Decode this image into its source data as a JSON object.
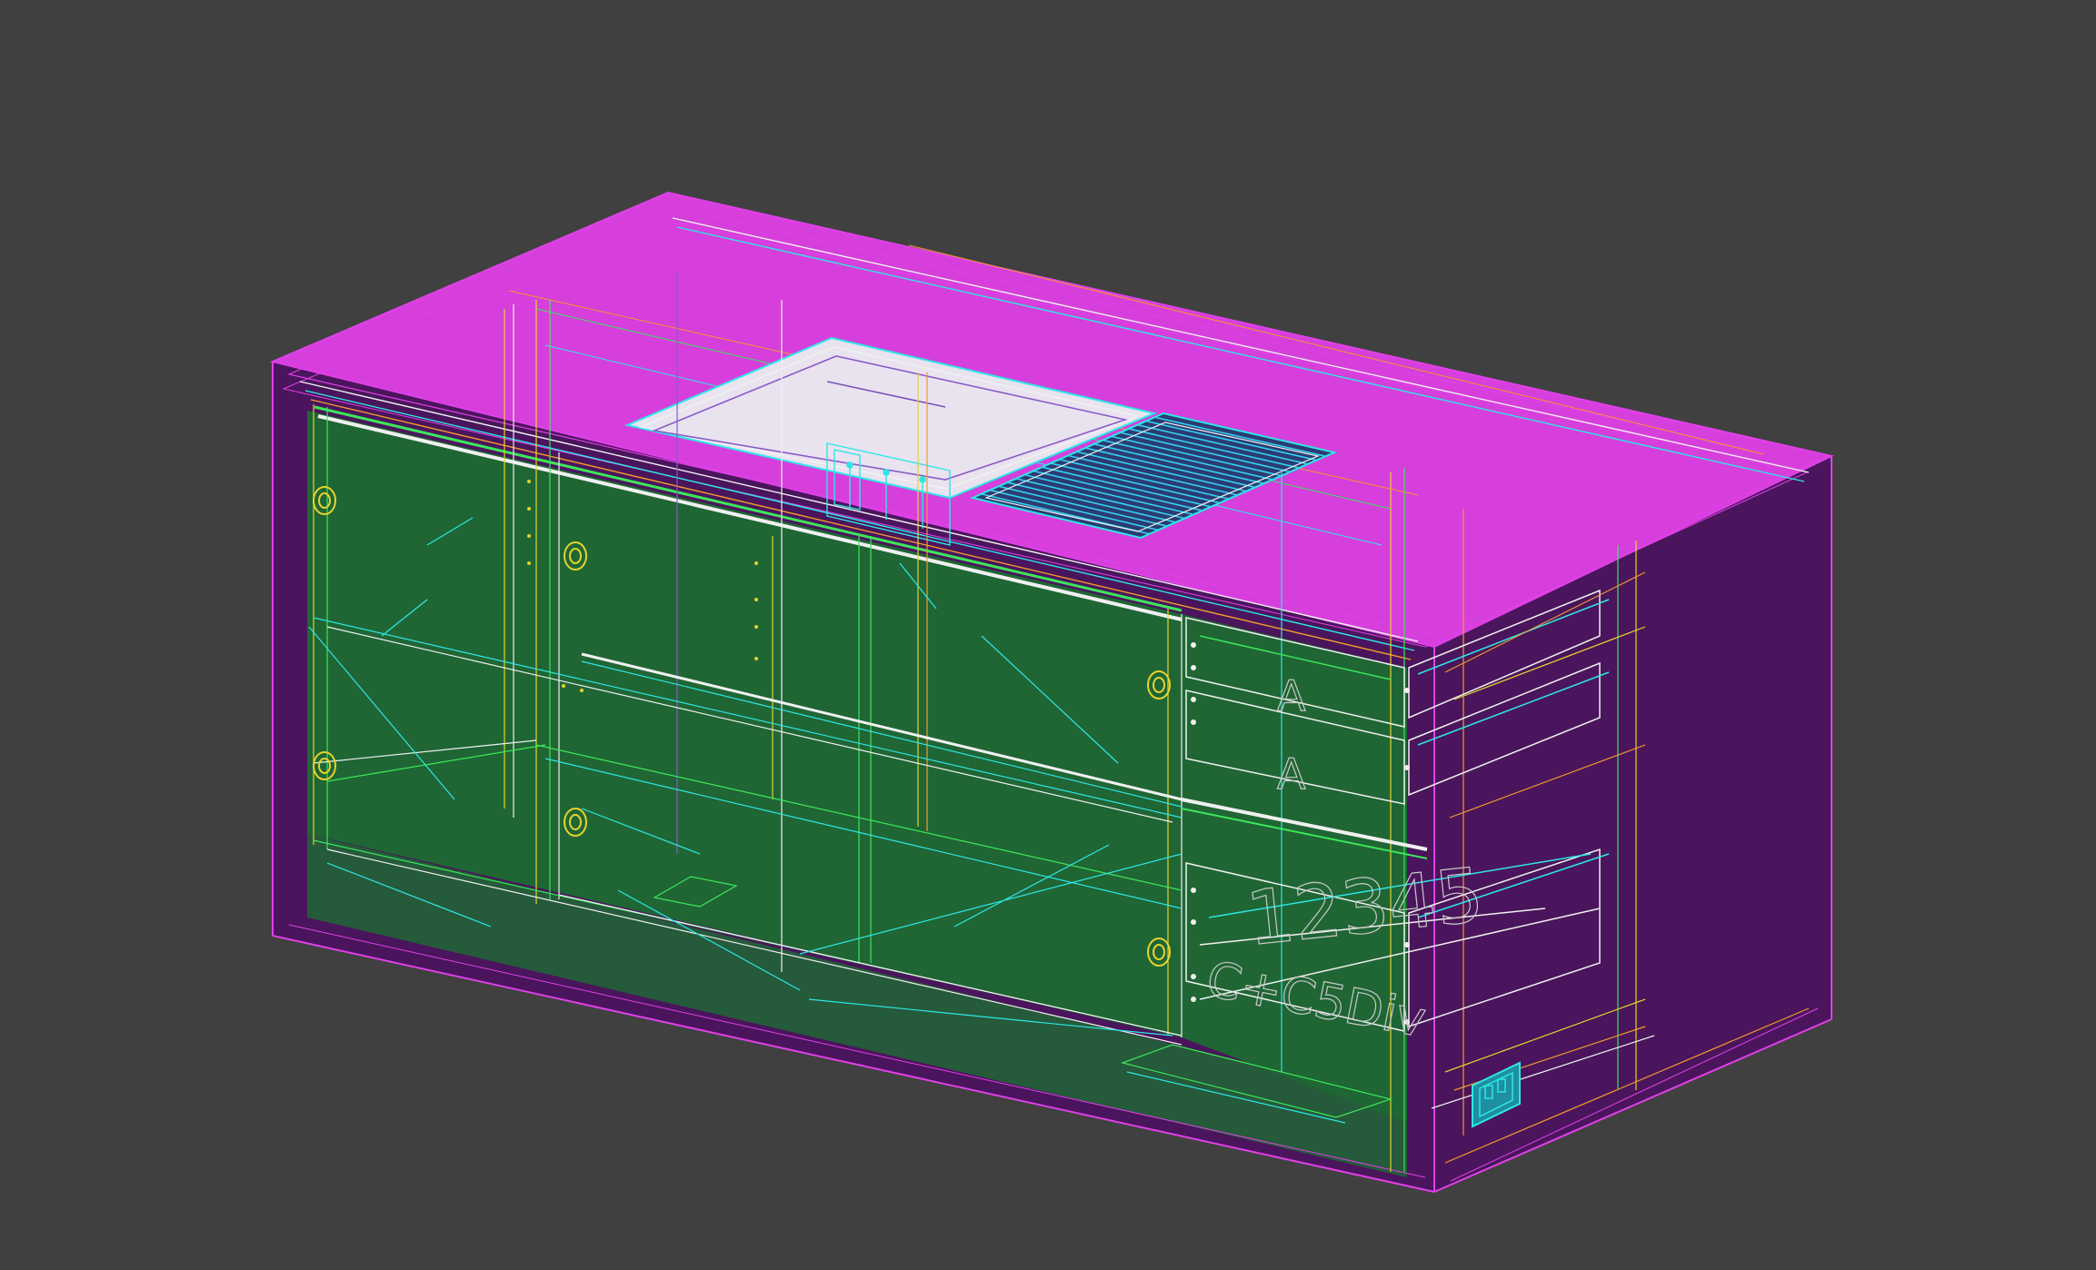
{
  "viewport": {
    "background": "#404040",
    "model": "cabinet-wireframe-3d"
  },
  "colors": {
    "top_face": "#D63FDC",
    "side_face": "#4A155C",
    "front_face": "#1F6634",
    "outline": "#E040E8",
    "edge_white": "#F0F0F0",
    "edge_cyan": "#2EE6E6",
    "edge_green": "#3CE65A",
    "edge_yellow": "#E6D22E",
    "edge_orange": "#F09A2E",
    "hatch_blue": "#36D0F0"
  },
  "labels": {
    "drawer_a1": "A",
    "drawer_a2": "A",
    "block_text": "12345",
    "model_label": "C+C5Div"
  },
  "icons": {
    "outlet": "electrical-outlet-icon",
    "knob": "cabinet-knob-icon"
  }
}
